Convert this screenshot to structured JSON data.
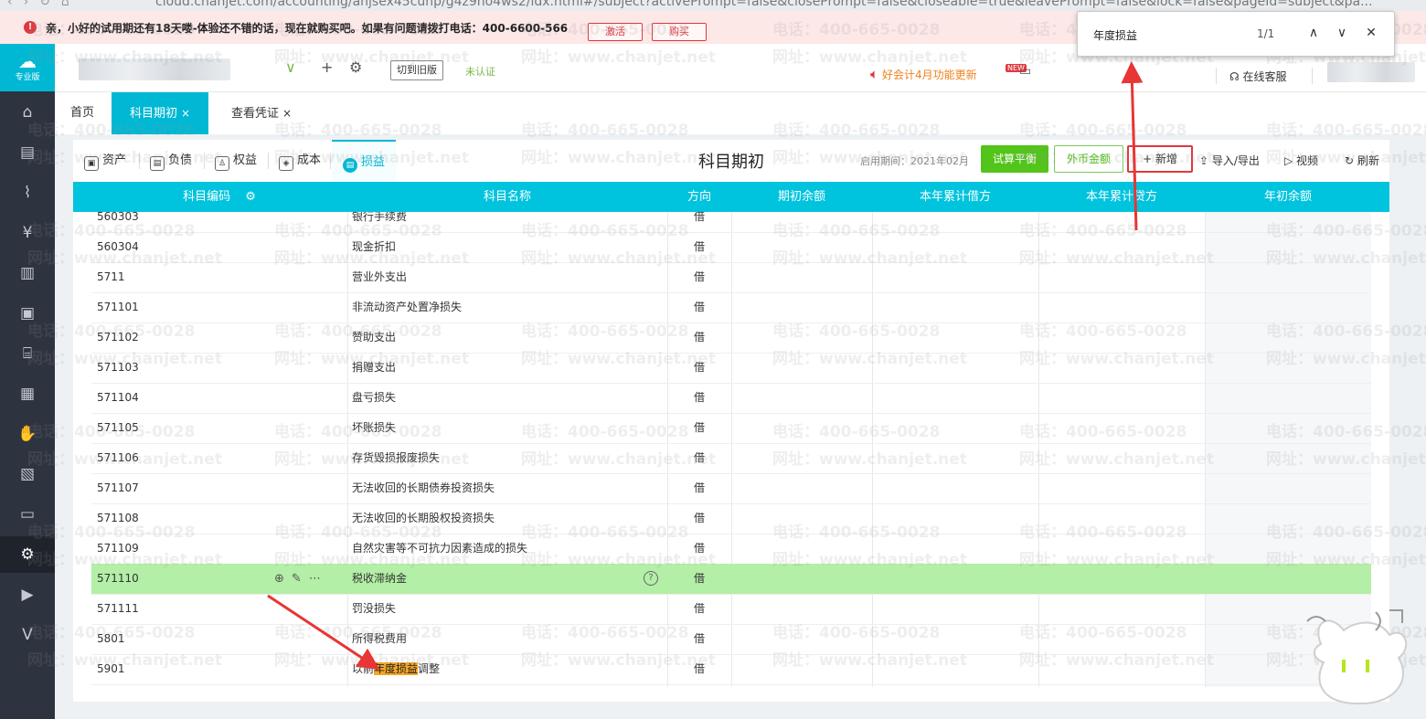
{
  "browser": {
    "url": "cloud.chanjet.com/accounting/anjsex45cunp/g4z9no4ws2/idx.html#/subject?activePrompt=false&closePrompt=false&closeable=true&leavePrompt=false&lock=false&pageId=subject&pa..."
  },
  "banner": {
    "message": "亲，小好的试用期还有18天喽-体验还不错的话，现在就购买吧。如果有问题请拨打电话：400-6600-566",
    "activate": "激活",
    "buy": "购买"
  },
  "find": {
    "query": "年度损益",
    "count": "1/1"
  },
  "logo": {
    "label": "专业版"
  },
  "header": {
    "switch_old": "切到旧版",
    "unverified": "未认证",
    "update_notice": "好会计4月功能更新",
    "new_badge": "NEW",
    "online_service": "在线客服"
  },
  "page_tabs": [
    {
      "label": "首页"
    },
    {
      "label": "科目期初"
    },
    {
      "label": "查看凭证"
    }
  ],
  "category_tabs": [
    {
      "label": "资产",
      "icon": "asset-icon"
    },
    {
      "label": "负债",
      "icon": "liability-icon"
    },
    {
      "label": "权益",
      "icon": "equity-icon"
    },
    {
      "label": "成本",
      "icon": "cost-icon"
    },
    {
      "label": "损益",
      "icon": "profit-loss-icon"
    }
  ],
  "title": "科目期初",
  "start_period": "启用期间：2021年02月",
  "toolbar": {
    "trial_balance": "试算平衡",
    "foreign_amount": "外币金额",
    "add_new": "+ 新增",
    "import_export": "导入/导出",
    "video": "视频",
    "refresh": "刷新"
  },
  "columns": [
    "科目编码",
    "科目名称",
    "方向",
    "期初余额",
    "本年累计借方",
    "本年累计贷方",
    "年初余额"
  ],
  "rows": [
    {
      "code": "560303",
      "name": "银行手续费",
      "dir": "借"
    },
    {
      "code": "560304",
      "name": "现金折扣",
      "dir": "借"
    },
    {
      "code": "5711",
      "name": "营业外支出",
      "dir": "借"
    },
    {
      "code": "571101",
      "name": "非流动资产处置净损失",
      "dir": "借"
    },
    {
      "code": "571102",
      "name": "赞助支出",
      "dir": "借"
    },
    {
      "code": "571103",
      "name": "捐赠支出",
      "dir": "借"
    },
    {
      "code": "571104",
      "name": "盘亏损失",
      "dir": "借"
    },
    {
      "code": "571105",
      "name": "坏账损失",
      "dir": "借"
    },
    {
      "code": "571106",
      "name": "存货毁损报废损失",
      "dir": "借"
    },
    {
      "code": "571107",
      "name": "无法收回的长期债券投资损失",
      "dir": "借"
    },
    {
      "code": "571108",
      "name": "无法收回的长期股权投资损失",
      "dir": "借"
    },
    {
      "code": "571109",
      "name": "自然灾害等不可抗力因素造成的损失",
      "dir": "借"
    },
    {
      "code": "571110",
      "name": "税收滞纳金",
      "dir": "借"
    },
    {
      "code": "571111",
      "name": "罚没损失",
      "dir": "借"
    },
    {
      "code": "5801",
      "name": "所得税费用",
      "dir": "借"
    },
    {
      "code": "5901",
      "name_prefix": "以前",
      "name_match": "年度损益",
      "name_suffix": "调整",
      "dir": "借"
    }
  ],
  "watermark": {
    "phone": "电话：400-665-0028",
    "site": "网址：www.chanjet.net"
  },
  "colors": {
    "accent": "#00b8d4",
    "highlight_row": "#b3efa6",
    "annotation": "#e0383e",
    "match": "#f5a623"
  }
}
